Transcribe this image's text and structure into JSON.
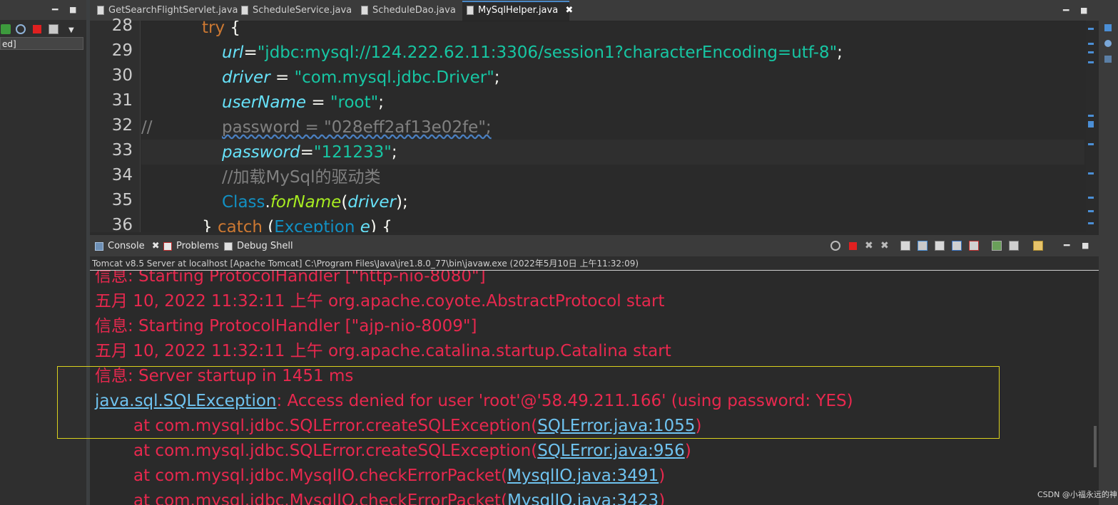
{
  "left_panel": {
    "input_value": "ed]",
    "minimize_label": "━",
    "maximize_label": "■",
    "dropdown_label": "▼"
  },
  "editor": {
    "tabs": [
      {
        "label": "GetSearchFlightServlet.java",
        "active": false
      },
      {
        "label": "ScheduleService.java",
        "active": false
      },
      {
        "label": "ScheduleDao.java",
        "active": false
      },
      {
        "label": "MySqlHelper.java",
        "active": true
      }
    ],
    "close_label": "✖",
    "minimize_label": "━",
    "maximize_label": "■",
    "line_numbers": [
      "28",
      "29",
      "30",
      "31",
      "32",
      "33",
      "34",
      "35",
      "36"
    ],
    "code": {
      "l28_kw": "try",
      "l28_brace": " {",
      "l29_field": "url",
      "l29_eq": "=",
      "l29_str": "\"jdbc:mysql://124.222.62.11:3306/session1?characterEncoding=utf-8\"",
      "l29_end": ";",
      "l30_field": "driver",
      "l30_eq": " = ",
      "l30_str": "\"com.mysql.jdbc.Driver\"",
      "l30_end": ";",
      "l31_field": "userName",
      "l31_eq": " = ",
      "l31_str": "\"root\"",
      "l31_end": ";",
      "l32_comment_prefix": "//",
      "l32_comment": "password = \"028eff2af13e02fe\";",
      "l33_field": "password",
      "l33_eq": "=",
      "l33_str": "\"121233\"",
      "l33_end": ";",
      "l34_comment": "//加载MySql的驱动类",
      "l35_class": "Class",
      "l35_dot": ".",
      "l35_method": "forName",
      "l35_open": "(",
      "l35_arg": "driver",
      "l35_close": ");",
      "l36_open": "} ",
      "l36_kw": "catch",
      "l36_paren": " (",
      "l36_class": "Exception",
      "l36_var": " e",
      "l36_end": ") {"
    }
  },
  "console": {
    "tabs": [
      {
        "label": "Console",
        "close": "✖"
      },
      {
        "label": "Problems"
      },
      {
        "label": "Debug Shell"
      }
    ],
    "description": "Tomcat v8.5 Server at localhost [Apache Tomcat] C:\\Program Files\\Java\\jre1.8.0_77\\bin\\javaw.exe (2022年5月10日 上午11:32:09)",
    "minimize_label": "━",
    "maximize_label": "■",
    "lines": {
      "l1": "信息: Starting ProtocolHandler [\"http-nio-8080\"]",
      "l2": "五月 10, 2022 11:32:11 上午 org.apache.coyote.AbstractProtocol start",
      "l3": "信息: Starting ProtocolHandler [\"ajp-nio-8009\"]",
      "l4": "五月 10, 2022 11:32:11 上午 org.apache.catalina.startup.Catalina start",
      "l5": "信息: Server startup in 1451 ms",
      "l6_link": "java.sql.SQLException",
      "l6_msg": ": Access denied for user 'root'@'58.49.211.166' (using password: YES)",
      "l7_prefix": "at com.mysql.jdbc.SQLError.createSQLException(",
      "l7_link": "SQLError.java:1055",
      "l7_suffix": ")",
      "l8_prefix": "at com.mysql.jdbc.SQLError.createSQLException(",
      "l8_link": "SQLError.java:956",
      "l8_suffix": ")",
      "l9_prefix": "at com.mysql.jdbc.MysqlIO.checkErrorPacket(",
      "l9_link": "MysqlIO.java:3491",
      "l9_suffix": ")",
      "l10_prefix": "at com.mysql.jdbc.MysqlIO.checkErrorPacket(",
      "l10_link": "MysqlIO.java:3423",
      "l10_suffix": ")"
    }
  },
  "watermark": "CSDN @小福永远的神",
  "colors": {
    "keyword": "#cc7832",
    "field": "#66e1f8",
    "string": "#17c6a3",
    "error_text": "#e8284e",
    "link": "#6fc3f0",
    "highlight_box": "#d9d11e"
  }
}
